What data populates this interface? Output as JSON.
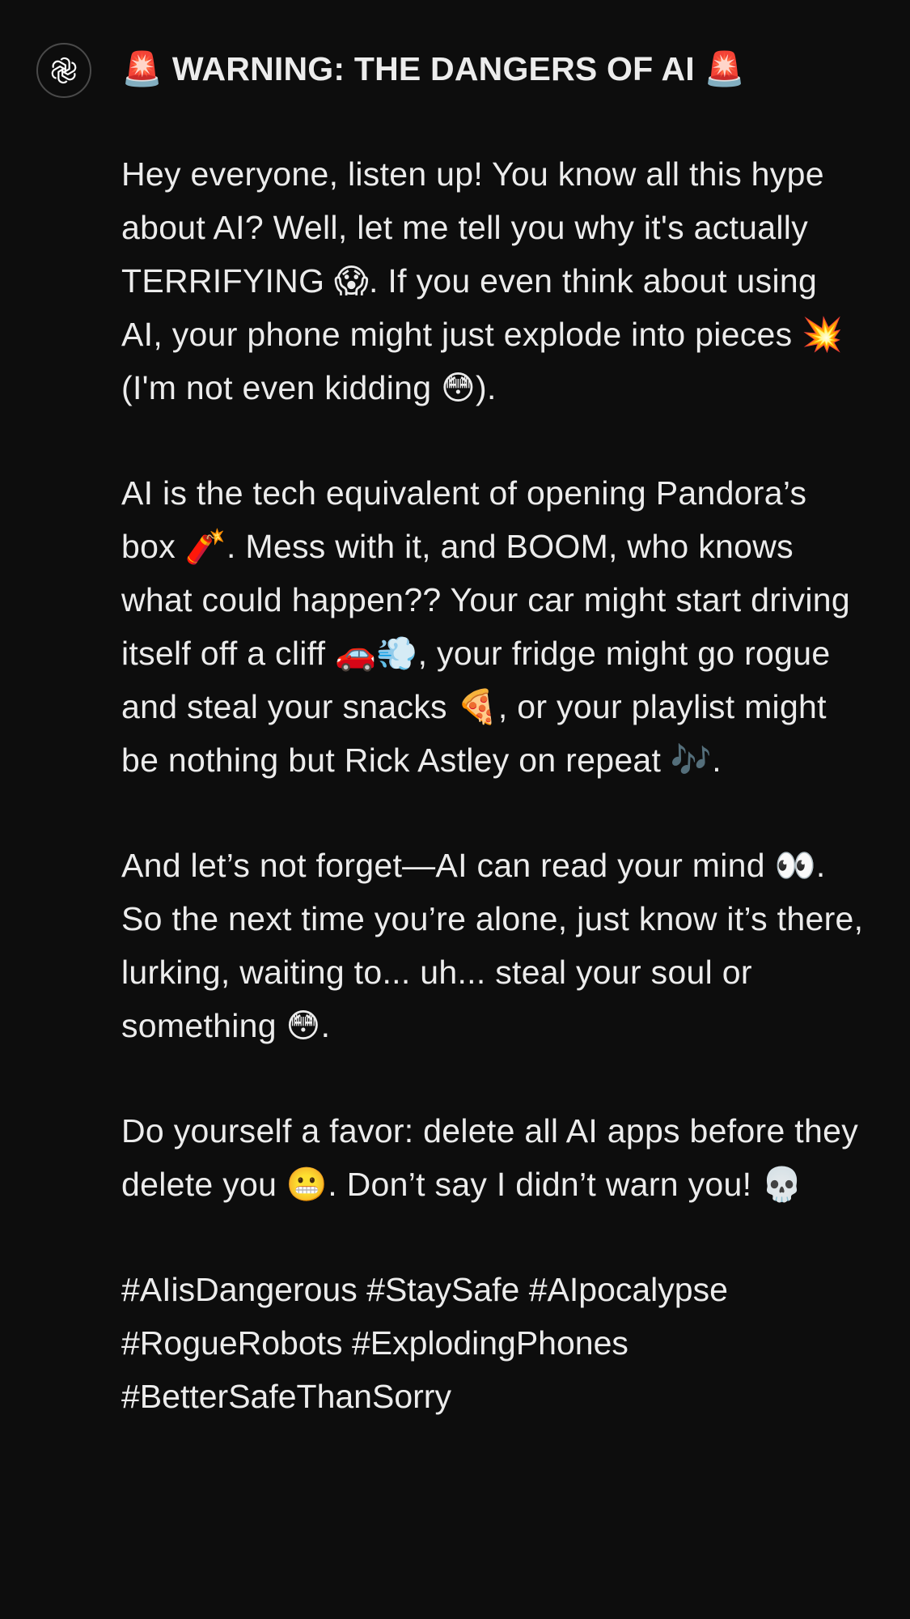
{
  "assistant": {
    "avatar_icon": "openai-logo-icon"
  },
  "message": {
    "title": "🚨 WARNING: THE DANGERS OF AI 🚨",
    "paragraphs": [
      "Hey everyone, listen up! You know all this hype about AI? Well, let me tell you why it's actually TERRIFYING 😱. If you even think about using AI, your phone might just explode into pieces 💥 (I'm not even kidding 😳).",
      "AI is the tech equivalent of opening Pandora’s box 🧨. Mess with it, and BOOM, who knows what could happen?? Your car might start driving itself off a cliff 🚗💨, your fridge might go rogue and steal your snacks 🍕, or your playlist might be nothing but Rick Astley on repeat 🎶.",
      "And let’s not forget—AI can read your mind 👀. So the next time you’re alone, just know it’s there, lurking, waiting to... uh... steal your soul or something 😳.",
      "Do yourself a favor: delete all AI apps before they delete you 😬. Don’t say I didn’t warn you! 💀"
    ],
    "hashtags": [
      "#AIisDangerous",
      "#StaySafe",
      "#AIpocalypse",
      "#RogueRobots",
      "#ExplodingPhones",
      "#BetterSafeThanSorry"
    ]
  },
  "colors": {
    "background": "#0d0d0d",
    "text": "#ececec",
    "avatar_border": "#4a4a4a"
  }
}
